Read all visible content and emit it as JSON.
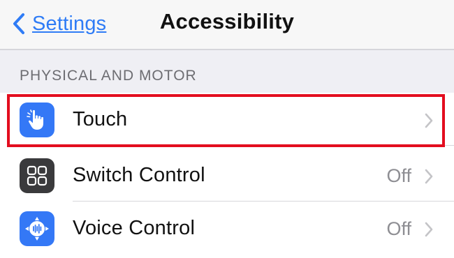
{
  "navbar": {
    "back_label": "Settings",
    "title": "Accessibility"
  },
  "section": {
    "header": "PHYSICAL AND MOTOR"
  },
  "rows": [
    {
      "label": "Touch",
      "value": "",
      "icon": "touch-hand-icon",
      "icon_color": "#3478f6"
    },
    {
      "label": "Switch Control",
      "value": "Off",
      "icon": "switch-grid-icon",
      "icon_color": "#3a3a3c"
    },
    {
      "label": "Voice Control",
      "value": "Off",
      "icon": "voice-control-icon",
      "icon_color": "#3478f6"
    }
  ],
  "highlight": {
    "target": "Touch",
    "color": "#e30d1f"
  },
  "colors": {
    "accent": "#2f7cf6",
    "background": "#efeff4",
    "secondary_text": "#8e8e93"
  }
}
